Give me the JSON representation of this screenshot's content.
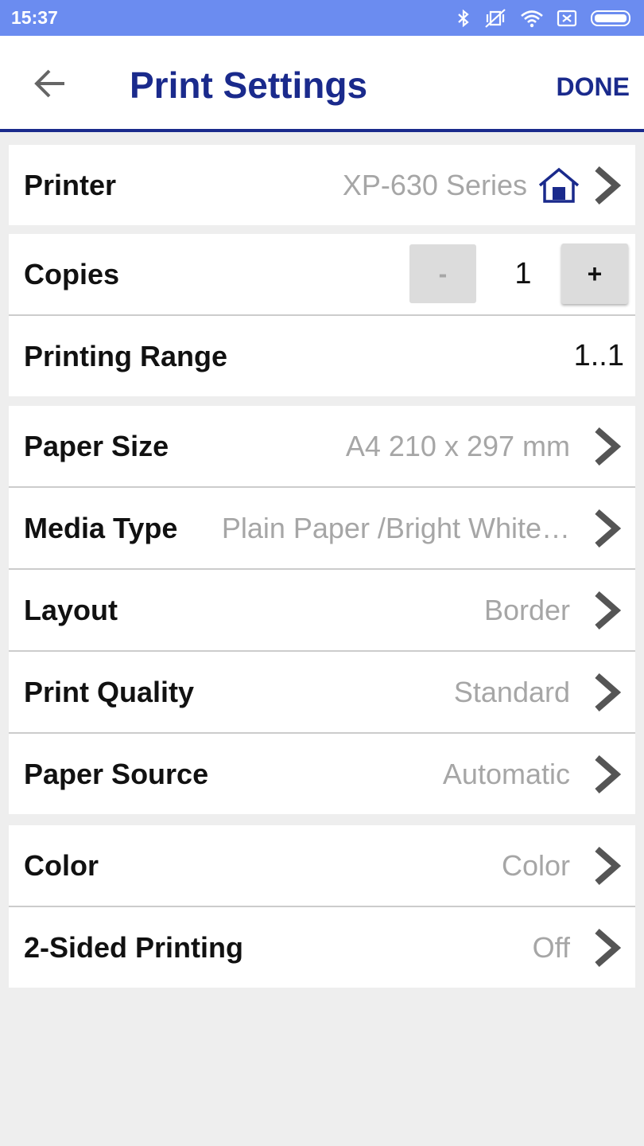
{
  "status_bar": {
    "time": "15:37"
  },
  "header": {
    "title": "Print Settings",
    "done_label": "DONE"
  },
  "printer": {
    "label": "Printer",
    "value": "XP-630 Series"
  },
  "copies": {
    "label": "Copies",
    "minus": "-",
    "value": "1",
    "plus": "+"
  },
  "printing_range": {
    "label": "Printing Range",
    "value": "1..1"
  },
  "paper": [
    {
      "label": "Paper Size",
      "value": "A4 210 x 297 mm"
    },
    {
      "label": "Media Type",
      "value": "Plain Paper /Bright White…"
    },
    {
      "label": "Layout",
      "value": "Border"
    },
    {
      "label": "Print Quality",
      "value": "Standard"
    },
    {
      "label": "Paper Source",
      "value": "Automatic"
    }
  ],
  "output": [
    {
      "label": "Color",
      "value": "Color"
    },
    {
      "label": "2-Sided Printing",
      "value": "Off"
    }
  ],
  "colors": {
    "status_bar": "#6b8cf0",
    "accent": "#1a2a8c",
    "value_gray": "#a6a6a6"
  },
  "icons": [
    "bluetooth-icon",
    "vibrate-icon",
    "wifi-icon",
    "no-sim-icon",
    "battery-icon",
    "back-arrow-icon",
    "home-icon",
    "chevron-right-icon"
  ]
}
